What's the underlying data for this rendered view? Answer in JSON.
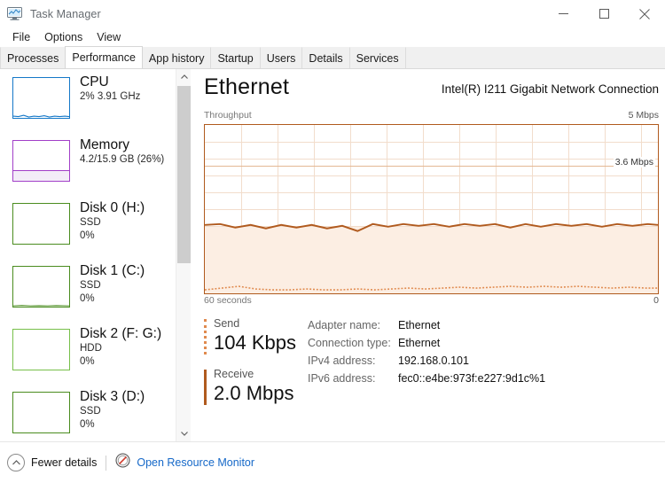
{
  "window": {
    "title": "Task Manager",
    "icon": "task-manager-icon",
    "controls": {
      "minimize": "minimize-icon",
      "maximize": "maximize-icon",
      "close": "close-icon"
    }
  },
  "menu": {
    "items": [
      "File",
      "Options",
      "View"
    ]
  },
  "tabs": {
    "items": [
      "Processes",
      "Performance",
      "App history",
      "Startup",
      "Users",
      "Details",
      "Services"
    ],
    "active": "Performance"
  },
  "sidebar": {
    "items": [
      {
        "title": "CPU",
        "sub1": "2% 3.91 GHz",
        "sub2": "",
        "color": "#1578c8",
        "fill": 2
      },
      {
        "title": "Memory",
        "sub1": "4.2/15.9 GB (26%)",
        "sub2": "",
        "color": "#a23fc8",
        "fill": 26
      },
      {
        "title": "Disk 0 (H:)",
        "sub1": "SSD",
        "sub2": "0%",
        "color": "#4a8c1f",
        "fill": 0
      },
      {
        "title": "Disk 1 (C:)",
        "sub1": "SSD",
        "sub2": "0%",
        "color": "#4a8c1f",
        "fill": 0
      },
      {
        "title": "Disk 2 (F: G:)",
        "sub1": "HDD",
        "sub2": "0%",
        "color": "#77c04a",
        "fill": 0
      },
      {
        "title": "Disk 3 (D:)",
        "sub1": "SSD",
        "sub2": "0%",
        "color": "#4a8c1f",
        "fill": 0
      }
    ],
    "scrollbar": {
      "up": "chevron-up-icon",
      "down": "chevron-down-icon"
    }
  },
  "main": {
    "title": "Ethernet",
    "adapter_heading": "Intel(R) I211 Gigabit Network Connection",
    "graph_label": "Throughput",
    "graph_max": "5 Mbps",
    "graph_peak": "3.6 Mbps",
    "graph_time": "60 seconds",
    "graph_min": "0",
    "send": {
      "label": "Send",
      "value": "104 Kbps"
    },
    "receive": {
      "label": "Receive",
      "value": "2.0 Mbps"
    },
    "info": [
      {
        "key": "Adapter name:",
        "value": "Ethernet"
      },
      {
        "key": "Connection type:",
        "value": "Ethernet"
      },
      {
        "key": "IPv4 address:",
        "value": "192.168.0.101"
      },
      {
        "key": "IPv6 address:",
        "value": "fec0::e4be:973f:e227:9d1c%1"
      }
    ]
  },
  "footer": {
    "fewer_details": "Fewer details",
    "fewer_icon": "chevron-up-circle-icon",
    "resource_monitor": "Open Resource Monitor",
    "resource_icon": "resource-monitor-icon"
  },
  "chart_data": {
    "type": "area",
    "title": "Throughput",
    "ylabel": "Mbps",
    "xlabel": "60 seconds",
    "ylim": [
      0,
      5
    ],
    "xlim": [
      -60,
      0
    ],
    "grid": true,
    "axis_labels": {
      "y_max": "5 Mbps",
      "y_min": "0",
      "x_left": "60 seconds",
      "peak_annotation": "3.6 Mbps"
    },
    "series": [
      {
        "name": "Receive",
        "color": "#b05a1e",
        "style": "solid",
        "fill": "#fceee3",
        "values": [
          2.05,
          2.02,
          2.0,
          1.98,
          2.0,
          2.03,
          2.0,
          1.97,
          2.0,
          2.02,
          1.99,
          1.96,
          1.99,
          2.02,
          2.0,
          1.98,
          2.01,
          2.03,
          2.0,
          1.97,
          1.95,
          1.98,
          2.01,
          2.0,
          1.98,
          2.0,
          2.02,
          2.0,
          1.99,
          2.01,
          2.0,
          1.98,
          2.0,
          2.02,
          2.01,
          1.99,
          2.0,
          2.03,
          2.01,
          1.98,
          2.0,
          2.02,
          2.0,
          1.99,
          2.01,
          2.03,
          2.0,
          1.98,
          2.0,
          2.02,
          2.0,
          1.99,
          2.01,
          2.0,
          1.98,
          2.0,
          2.02,
          2.0,
          2.01,
          2.0
        ]
      },
      {
        "name": "Send",
        "color": "#e08a4e",
        "style": "dotted",
        "values": [
          0.1,
          0.09,
          0.11,
          0.12,
          0.13,
          0.12,
          0.1,
          0.09,
          0.08,
          0.09,
          0.1,
          0.09,
          0.08,
          0.09,
          0.1,
          0.09,
          0.08,
          0.09,
          0.08,
          0.09,
          0.1,
          0.09,
          0.08,
          0.09,
          0.1,
          0.11,
          0.1,
          0.09,
          0.1,
          0.11,
          0.12,
          0.13,
          0.12,
          0.11,
          0.1,
          0.11,
          0.12,
          0.13,
          0.12,
          0.11,
          0.12,
          0.13,
          0.12,
          0.11,
          0.1,
          0.11,
          0.12,
          0.11,
          0.1,
          0.11,
          0.12,
          0.11,
          0.1,
          0.11,
          0.12,
          0.11,
          0.1,
          0.11,
          0.1,
          0.1
        ]
      }
    ]
  }
}
